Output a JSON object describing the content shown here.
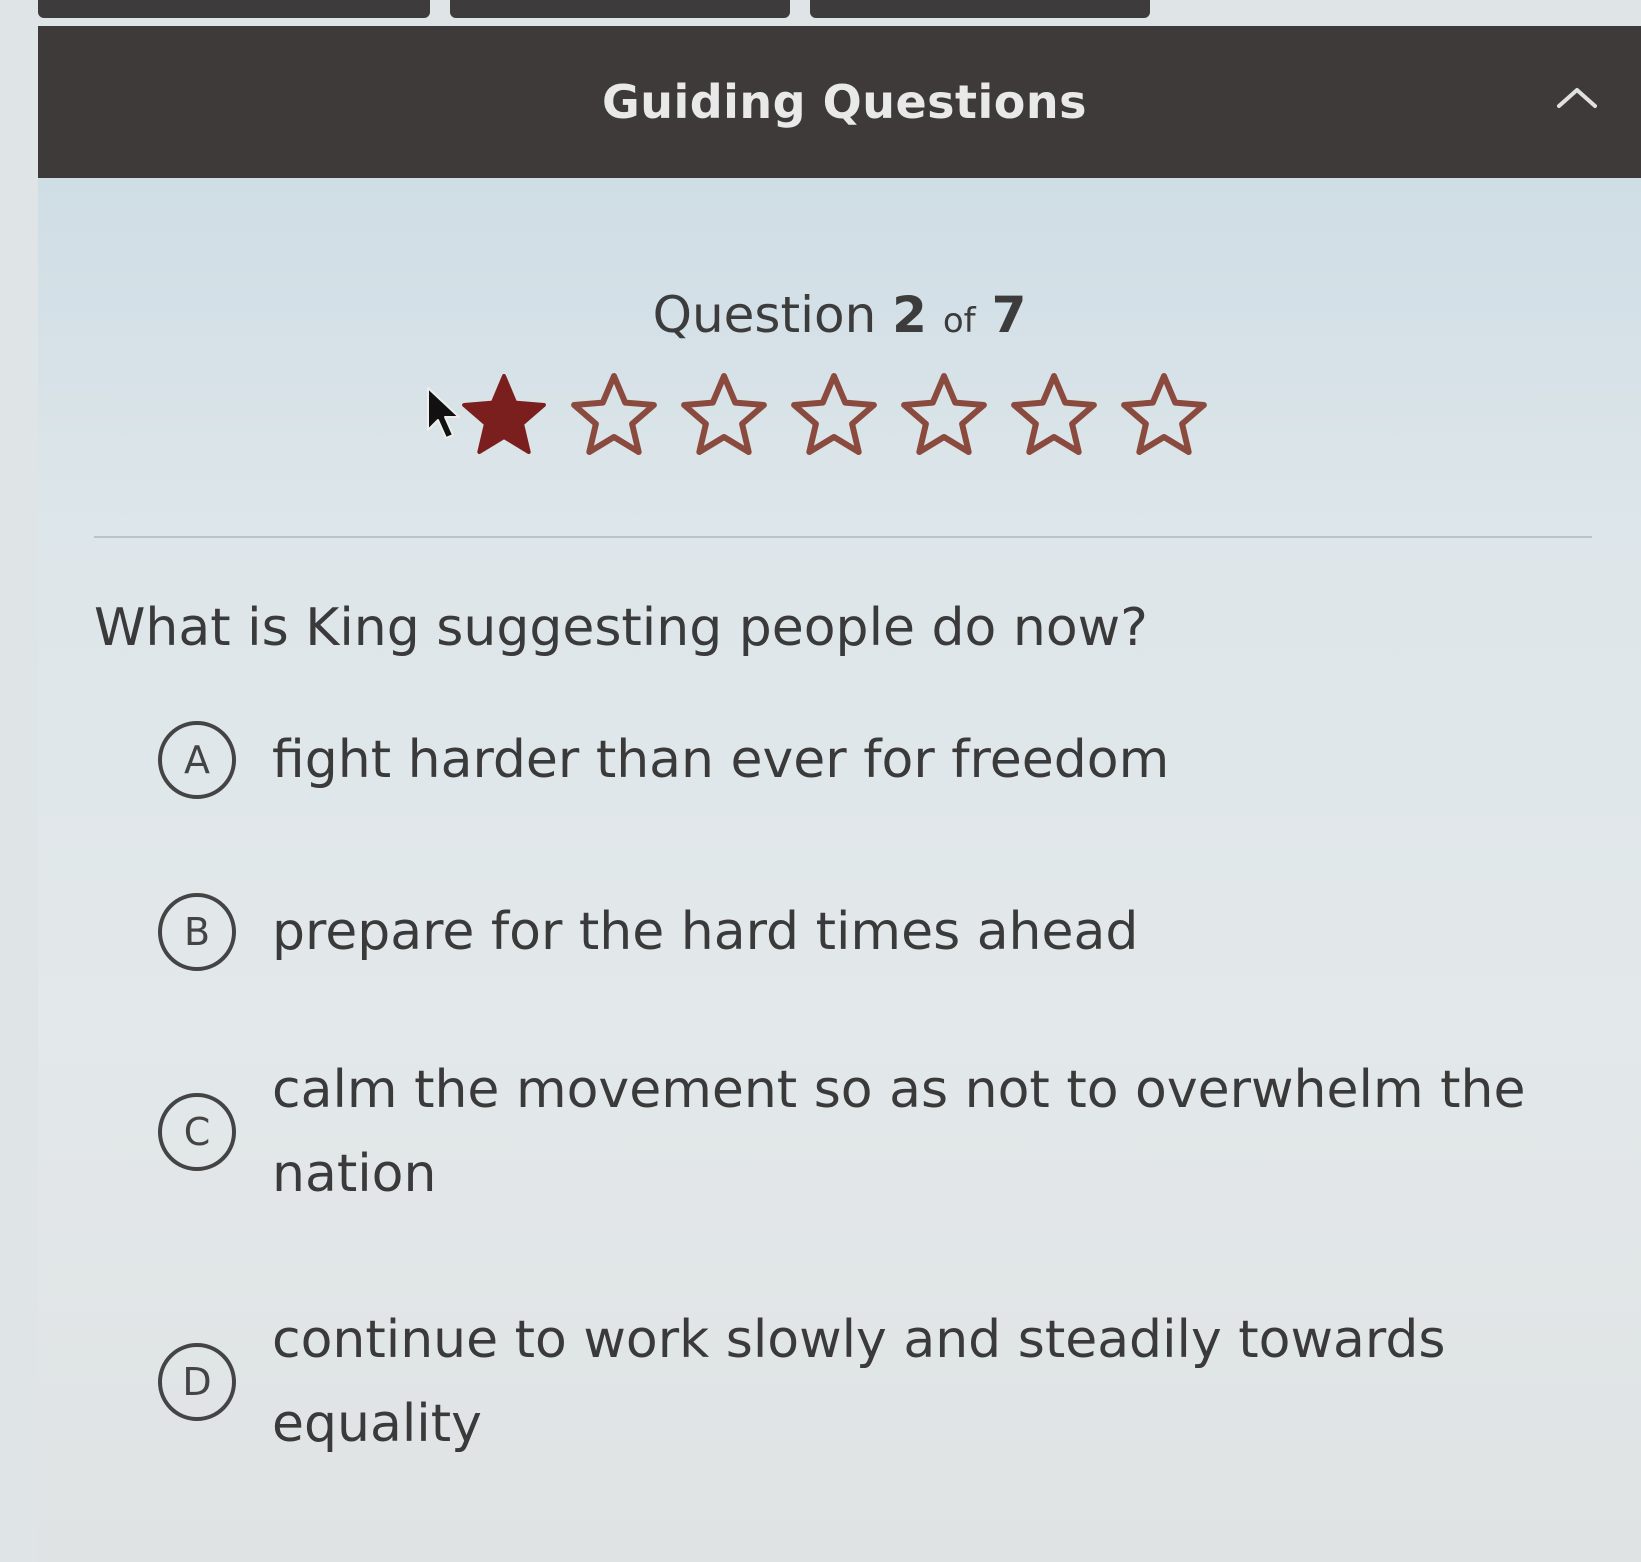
{
  "header": {
    "title": "Guiding Questions",
    "collapse_icon": "chevron-up-icon"
  },
  "progress": {
    "label": "Question",
    "current": "2",
    "of_label": "of",
    "total": "7",
    "stars_filled": 1,
    "stars_total": 7,
    "filled_color": "#7a1f1d",
    "empty_color": "#8a4a3e"
  },
  "question": {
    "text": "What is King suggesting people do now?"
  },
  "options": [
    {
      "letter": "A",
      "text": "fight harder than ever for freedom"
    },
    {
      "letter": "B",
      "text": "prepare for the hard times ahead"
    },
    {
      "letter": "C",
      "text": "calm the movement so as not to overwhelm the nation"
    },
    {
      "letter": "D",
      "text": "continue to work slowly and steadily towards equality"
    }
  ]
}
